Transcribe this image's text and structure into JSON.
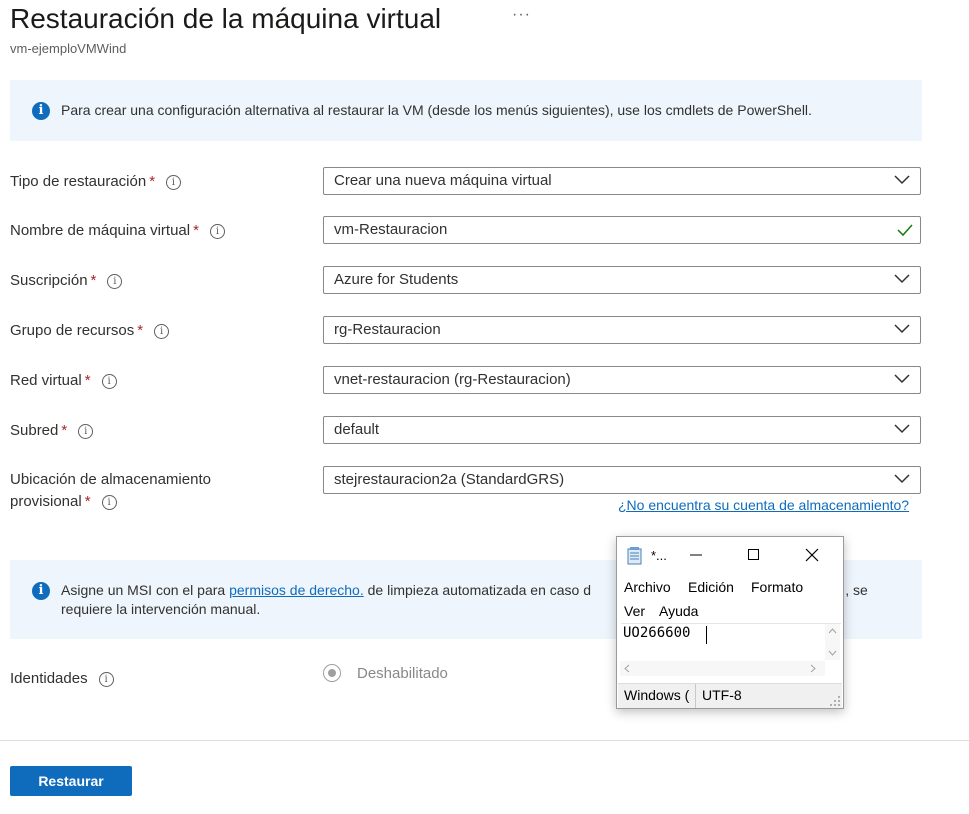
{
  "header": {
    "title": "Restauración de la máquina virtual",
    "more_label": "···",
    "subtitle": "vm-ejemploVMWind"
  },
  "banner_top": {
    "icon": "info-icon",
    "text": "Para crear una configuración alternativa al restaurar la VM (desde los menús siguientes), use los cmdlets de PowerShell."
  },
  "form": {
    "restore_type": {
      "label": "Tipo de restauración",
      "value": "Crear una nueva máquina virtual"
    },
    "vm_name": {
      "label": "Nombre de máquina virtual",
      "value": "vm-Restauracion"
    },
    "subscription": {
      "label": "Suscripción",
      "value": "Azure for Students"
    },
    "resource_group": {
      "label": "Grupo de recursos",
      "value": "rg-Restauracion"
    },
    "vnet": {
      "label": "Red virtual",
      "value": "vnet-restauracion (rg-Restauracion)"
    },
    "subnet": {
      "label": "Subred",
      "value": "default"
    },
    "storage": {
      "label_line1": "Ubicación de almacenamiento",
      "label_line2": "provisional",
      "value": "stejrestauracion2a (StandardGRS)",
      "link": "¿No encuentra su cuenta de almacenamiento?"
    },
    "required_mark": "*",
    "tooltip_glyph": "i"
  },
  "banner_msi": {
    "text_before": "Asigne un MSI con el para ",
    "link": "permisos de derecho.",
    "text_after": " de limpieza automatizada en caso d",
    "text_tail": "SI, se",
    "text_line2": "requiere la intervención manual."
  },
  "identities": {
    "label": "Identidades",
    "option": "Deshabilitado"
  },
  "footer": {
    "restore_button": "Restaurar"
  },
  "notepad": {
    "title": "*...",
    "menu": [
      "Archivo",
      "Edición",
      "Formato",
      "Ver",
      "Ayuda"
    ],
    "content": "UO266600",
    "status_line_ending": "Windows (",
    "status_encoding": "UTF-8"
  },
  "colors": {
    "accent": "#0f6cbd",
    "banner_bg": "#eef5fc",
    "required": "#a4262c",
    "valid_check": "#107c10"
  }
}
